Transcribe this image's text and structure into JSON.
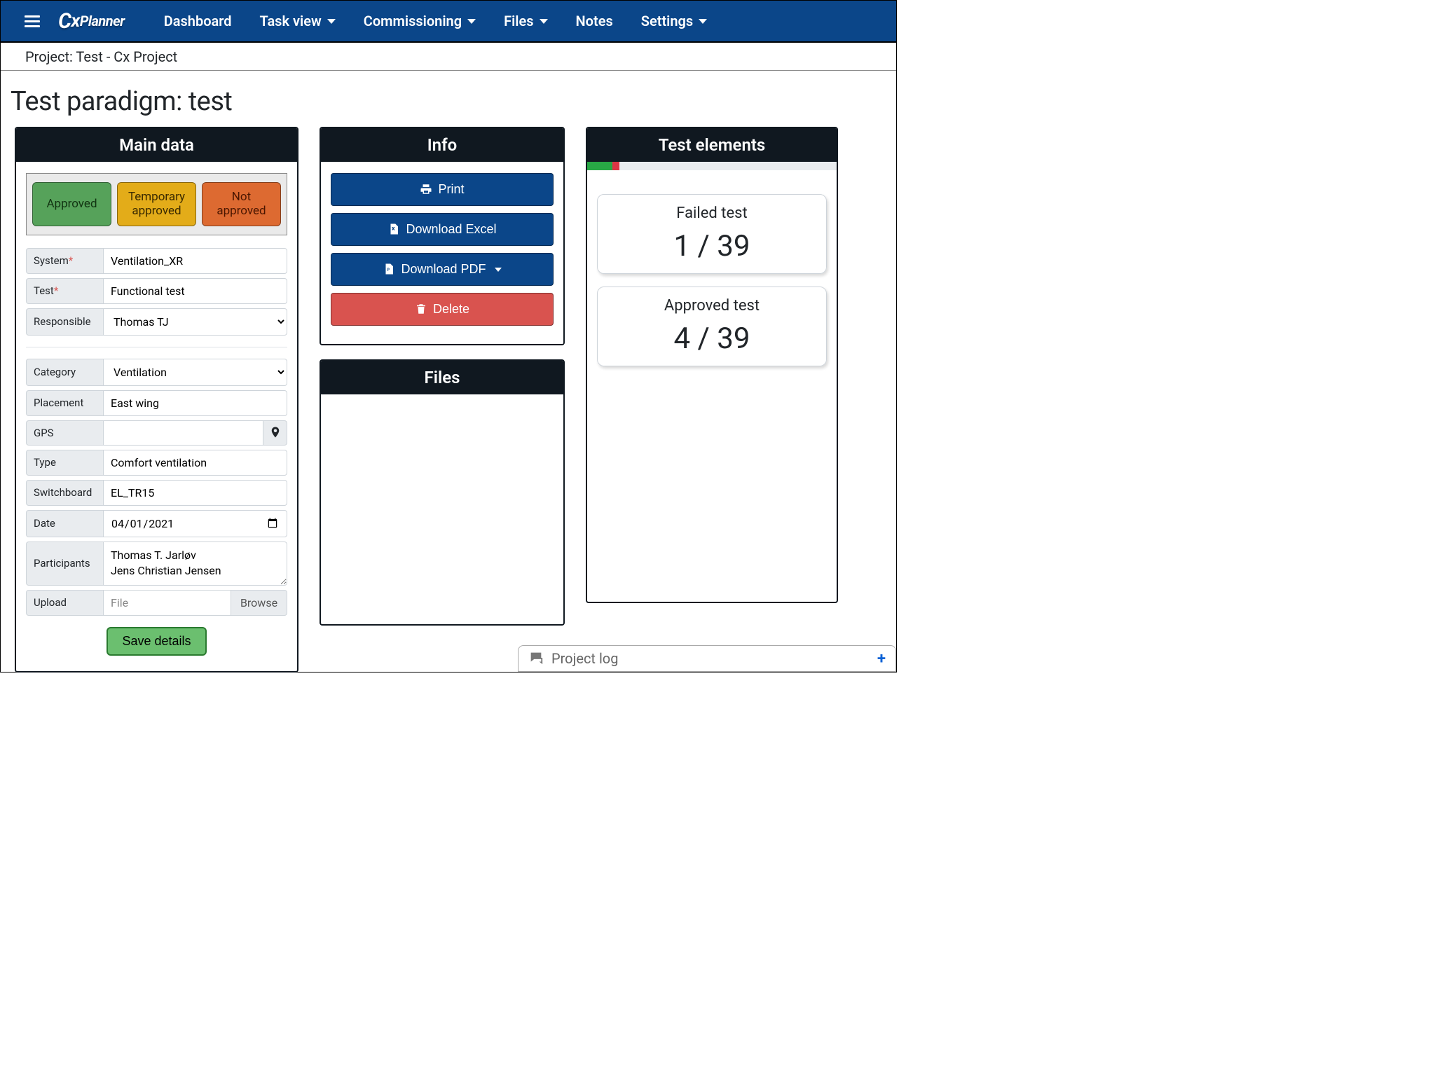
{
  "nav": {
    "dashboard": "Dashboard",
    "task_view": "Task view",
    "commissioning": "Commissioning",
    "files": "Files",
    "notes": "Notes",
    "settings": "Settings",
    "logo_text": "Planner"
  },
  "project_bar": "Project: Test - Cx Project",
  "page_title": "Test paradigm: test",
  "main_data": {
    "header": "Main data",
    "status": {
      "approved": "Approved",
      "temporary": "Temporary approved",
      "not_approved": "Not approved"
    },
    "labels": {
      "system": "System",
      "test": "Test",
      "responsible": "Responsible",
      "category": "Category",
      "placement": "Placement",
      "gps": "GPS",
      "type": "Type",
      "switchboard": "Switchboard",
      "date": "Date",
      "participants": "Participants",
      "upload": "Upload"
    },
    "values": {
      "system": "Ventilation_XR",
      "test": "Functional test",
      "responsible": "Thomas TJ",
      "category": "Ventilation",
      "placement": "East wing",
      "gps": "",
      "type": "Comfort ventilation",
      "switchboard": "EL_TR15",
      "date": "01/04/2021",
      "participants": "Thomas T. Jarløv\nJens Christian Jensen",
      "file_placeholder": "File",
      "browse": "Browse"
    },
    "save": "Save details"
  },
  "info": {
    "header": "Info",
    "print": "Print",
    "download_excel": "Download Excel",
    "download_pdf": "Download PDF",
    "delete": "Delete"
  },
  "files": {
    "header": "Files"
  },
  "test_elements": {
    "header": "Test elements",
    "progress": {
      "approved_pct": 10,
      "failed_pct": 3
    },
    "failed": {
      "title": "Failed test",
      "value": "1 / 39"
    },
    "approved": {
      "title": "Approved test",
      "value": "4 / 39"
    }
  },
  "project_log": {
    "label": "Project log"
  }
}
